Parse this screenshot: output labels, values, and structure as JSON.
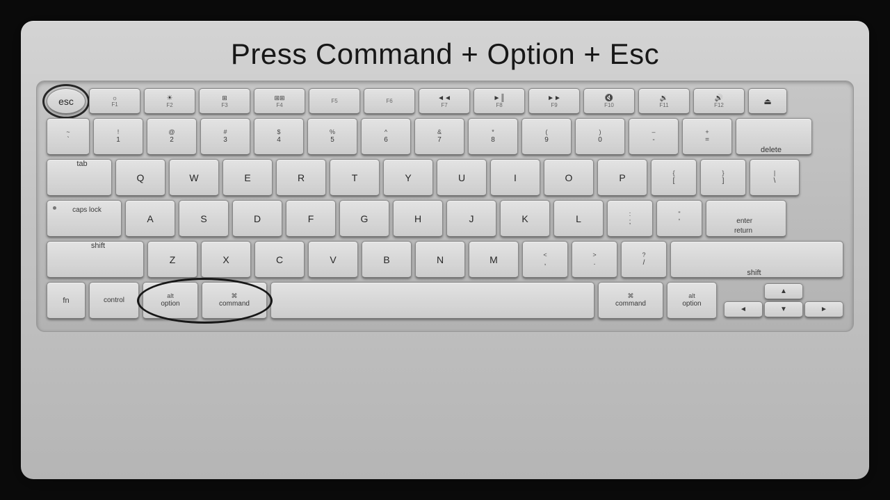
{
  "title": "Press Command + Option + Esc",
  "keyboard": {
    "rows": {
      "fn_row": [
        "esc",
        "F1",
        "F2",
        "F3",
        "F4",
        "F5",
        "F6",
        "F7",
        "F8",
        "F9",
        "F10",
        "F11",
        "F12",
        "eject"
      ],
      "number_row": [
        "~ `",
        "! 1",
        "@ 2",
        "# 3",
        "$ 4",
        "% 5",
        "^ 6",
        "& 7",
        "* 8",
        "( 9",
        ") 0",
        "– -",
        "+ =",
        "delete"
      ],
      "top_alpha": [
        "tab",
        "Q",
        "W",
        "E",
        "R",
        "T",
        "Y",
        "U",
        "I",
        "O",
        "P",
        "{ [",
        "} ]",
        "\\ |"
      ],
      "mid_alpha": [
        "caps lock",
        "A",
        "S",
        "D",
        "F",
        "G",
        "H",
        "J",
        "K",
        "L",
        ": ;",
        "\" '",
        "enter/return"
      ],
      "bot_alpha": [
        "shift",
        "Z",
        "X",
        "C",
        "V",
        "B",
        "N",
        "M",
        "< ,",
        "> .",
        "? /",
        "shift"
      ],
      "bottom_row": [
        "fn",
        "control",
        "alt/option",
        "⌘ command",
        "space",
        "⌘ command",
        "alt/option",
        "arrows"
      ]
    }
  },
  "highlighted_keys": [
    "esc",
    "option",
    "command"
  ],
  "colors": {
    "background": "#0a0a0a",
    "keyboard_body": "#c8c8c8",
    "key_face": "#e0e0e0",
    "key_text": "#333333",
    "circle_stroke": "#111111"
  }
}
